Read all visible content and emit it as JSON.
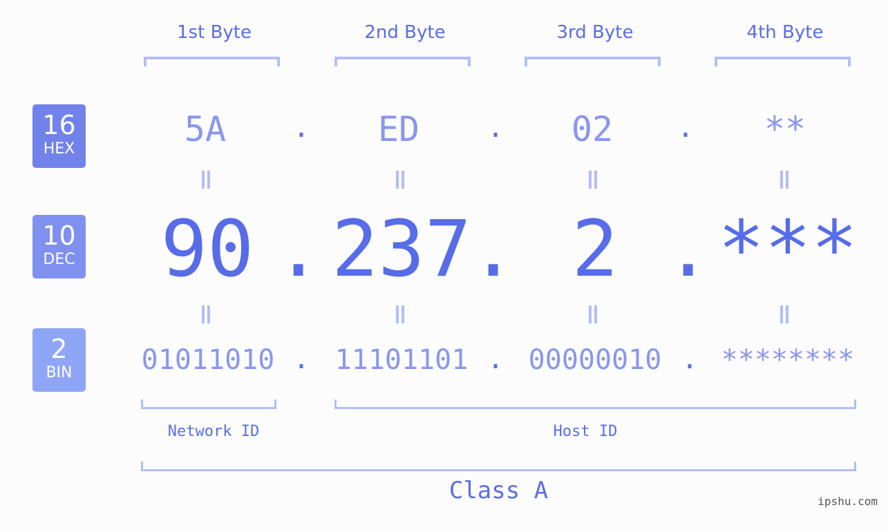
{
  "bases": [
    {
      "num": "16",
      "label": "HEX",
      "color": "#7182ea"
    },
    {
      "num": "10",
      "label": "DEC",
      "color": "#7f90ef"
    },
    {
      "num": "2",
      "label": "BIN",
      "color": "#8fa5f6"
    }
  ],
  "byte_labels": [
    "1st Byte",
    "2nd Byte",
    "3rd Byte",
    "4th Byte"
  ],
  "hex": [
    "5A",
    "ED",
    "02",
    "**"
  ],
  "dec": [
    "90",
    "237",
    "2",
    "***"
  ],
  "bin": [
    "01011010",
    "11101101",
    "00000010",
    "********"
  ],
  "separator": ".",
  "network_label": "Network ID",
  "host_label": "Host ID",
  "class_label": "Class A",
  "watermark": "ipshu.com"
}
